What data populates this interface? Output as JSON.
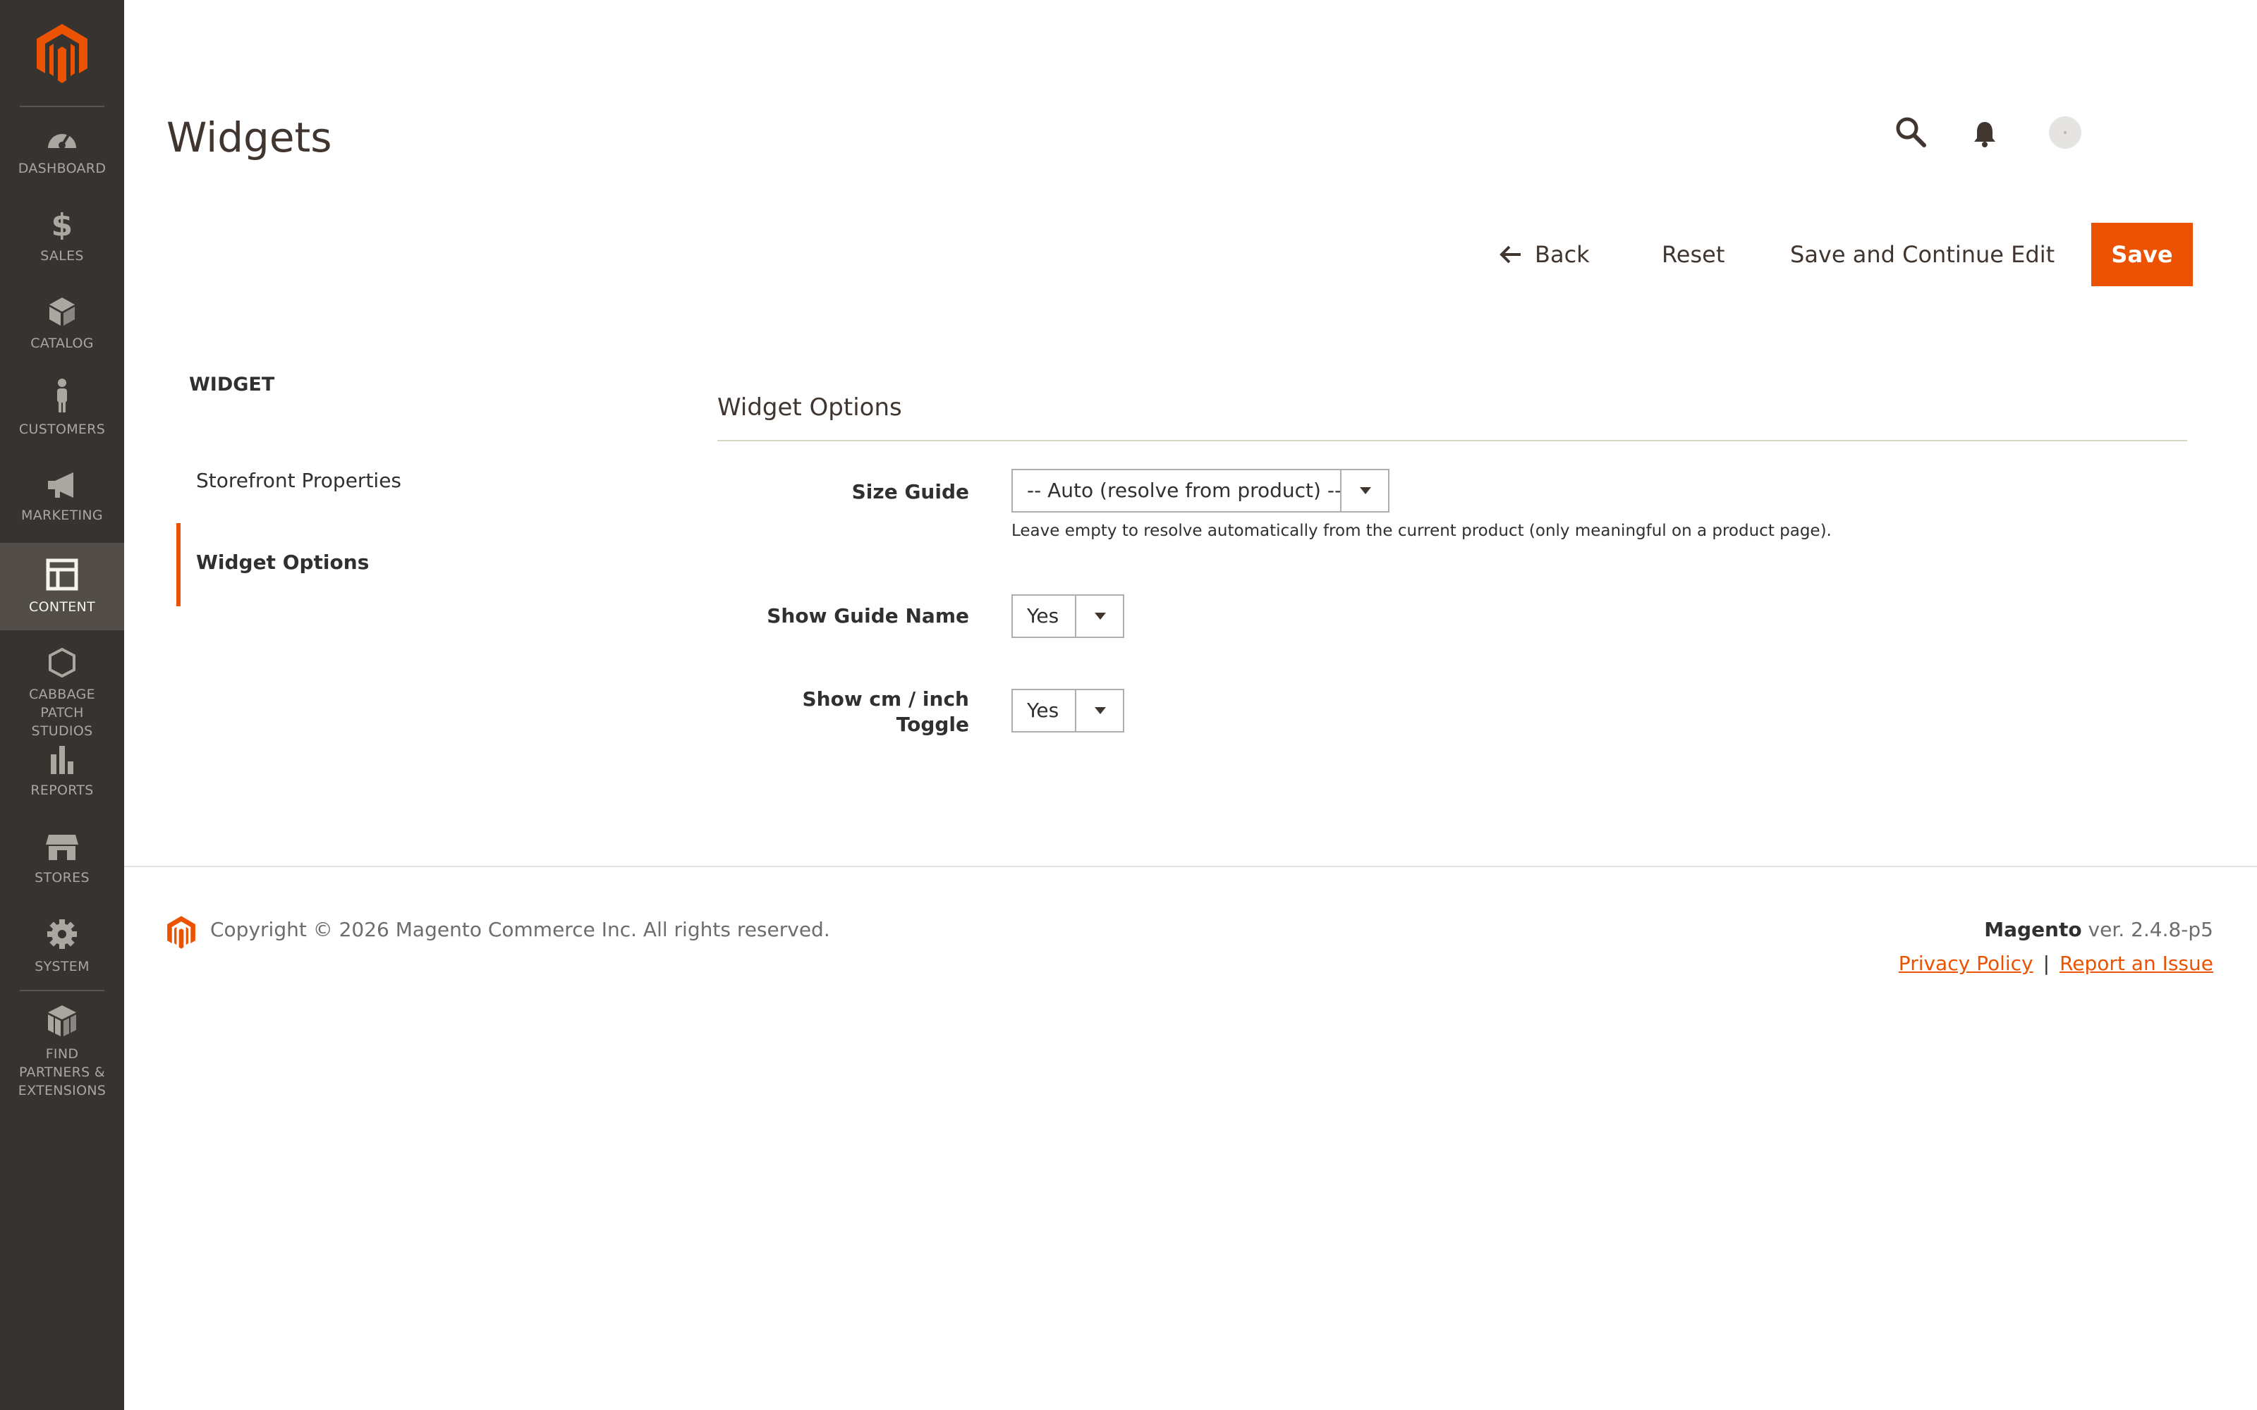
{
  "sidebar": {
    "items": [
      {
        "label": "DASHBOARD",
        "icon": "dashboard-icon"
      },
      {
        "label": "SALES",
        "icon": "dollar-icon"
      },
      {
        "label": "CATALOG",
        "icon": "cube-icon"
      },
      {
        "label": "CUSTOMERS",
        "icon": "person-icon"
      },
      {
        "label": "MARKETING",
        "icon": "megaphone-icon"
      },
      {
        "label": "CONTENT",
        "icon": "layout-icon",
        "active": true
      },
      {
        "label": "CABBAGE PATCH STUDIOS",
        "icon": "hexagon-icon"
      },
      {
        "label": "REPORTS",
        "icon": "bar-chart-icon"
      },
      {
        "label": "STORES",
        "icon": "store-icon"
      },
      {
        "label": "SYSTEM",
        "icon": "gear-icon"
      },
      {
        "label": "FIND PARTNERS & EXTENSIONS",
        "icon": "blocks-icon"
      }
    ]
  },
  "header": {
    "title": "Widgets"
  },
  "actions": {
    "back": "Back",
    "reset": "Reset",
    "save_continue": "Save and Continue Edit",
    "save": "Save"
  },
  "tabs": {
    "title": "WIDGET",
    "items": [
      {
        "label": "Storefront Properties"
      },
      {
        "label": "Widget Options",
        "active": true
      }
    ]
  },
  "form": {
    "section_title": "Widget Options",
    "size_guide": {
      "label": "Size Guide",
      "value": "-- Auto (resolve from product) --",
      "note": "Leave empty to resolve automatically from the current product (only meaningful on a product page)."
    },
    "show_guide_name": {
      "label": "Show Guide Name",
      "value": "Yes"
    },
    "show_toggle": {
      "label_line1": "Show cm / inch",
      "label_line2": "Toggle",
      "value": "Yes"
    }
  },
  "footer": {
    "copyright": "Copyright © 2026 Magento Commerce Inc. All rights reserved.",
    "brand": "Magento",
    "version": " ver. 2.4.8-p5",
    "privacy": "Privacy Policy",
    "separator": "|",
    "report": "Report an Issue"
  },
  "colors": {
    "accent": "#eb5202",
    "sidebar_bg": "#373330",
    "sidebar_active": "#524d49"
  }
}
